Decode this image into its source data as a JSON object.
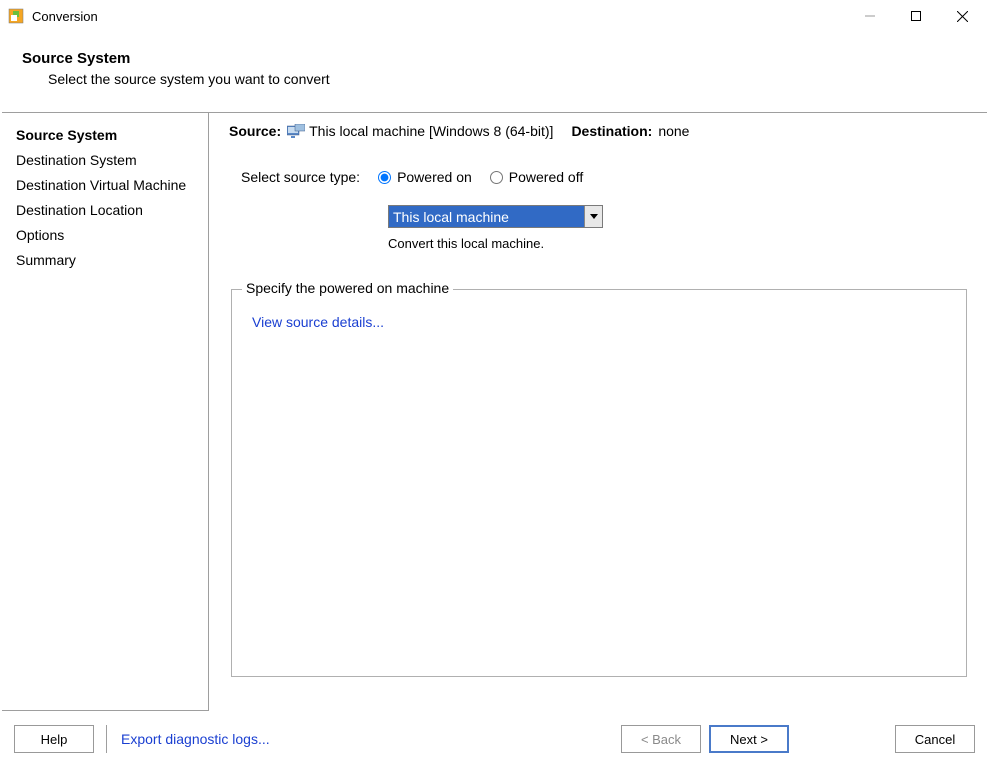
{
  "window": {
    "title": "Conversion"
  },
  "header": {
    "title": "Source System",
    "subtitle": "Select the source system you want to convert"
  },
  "sidebar": {
    "steps": [
      "Source System",
      "Destination System",
      "Destination Virtual Machine",
      "Destination Location",
      "Options",
      "Summary"
    ],
    "current_index": 0
  },
  "main": {
    "source_label": "Source:",
    "source_value": "This local machine [Windows 8 (64-bit)]",
    "destination_label": "Destination:",
    "destination_value": "none",
    "select_type_label": "Select source type:",
    "radio_on": "Powered on",
    "radio_off": "Powered off",
    "radio_selected": "on",
    "dropdown_value": "This local machine",
    "hint": "Convert this local machine.",
    "fieldset_legend": "Specify the powered on machine",
    "details_link": "View source details..."
  },
  "footer": {
    "help": "Help",
    "export_link": "Export diagnostic logs...",
    "back": "< Back",
    "next": "Next >",
    "cancel": "Cancel"
  }
}
